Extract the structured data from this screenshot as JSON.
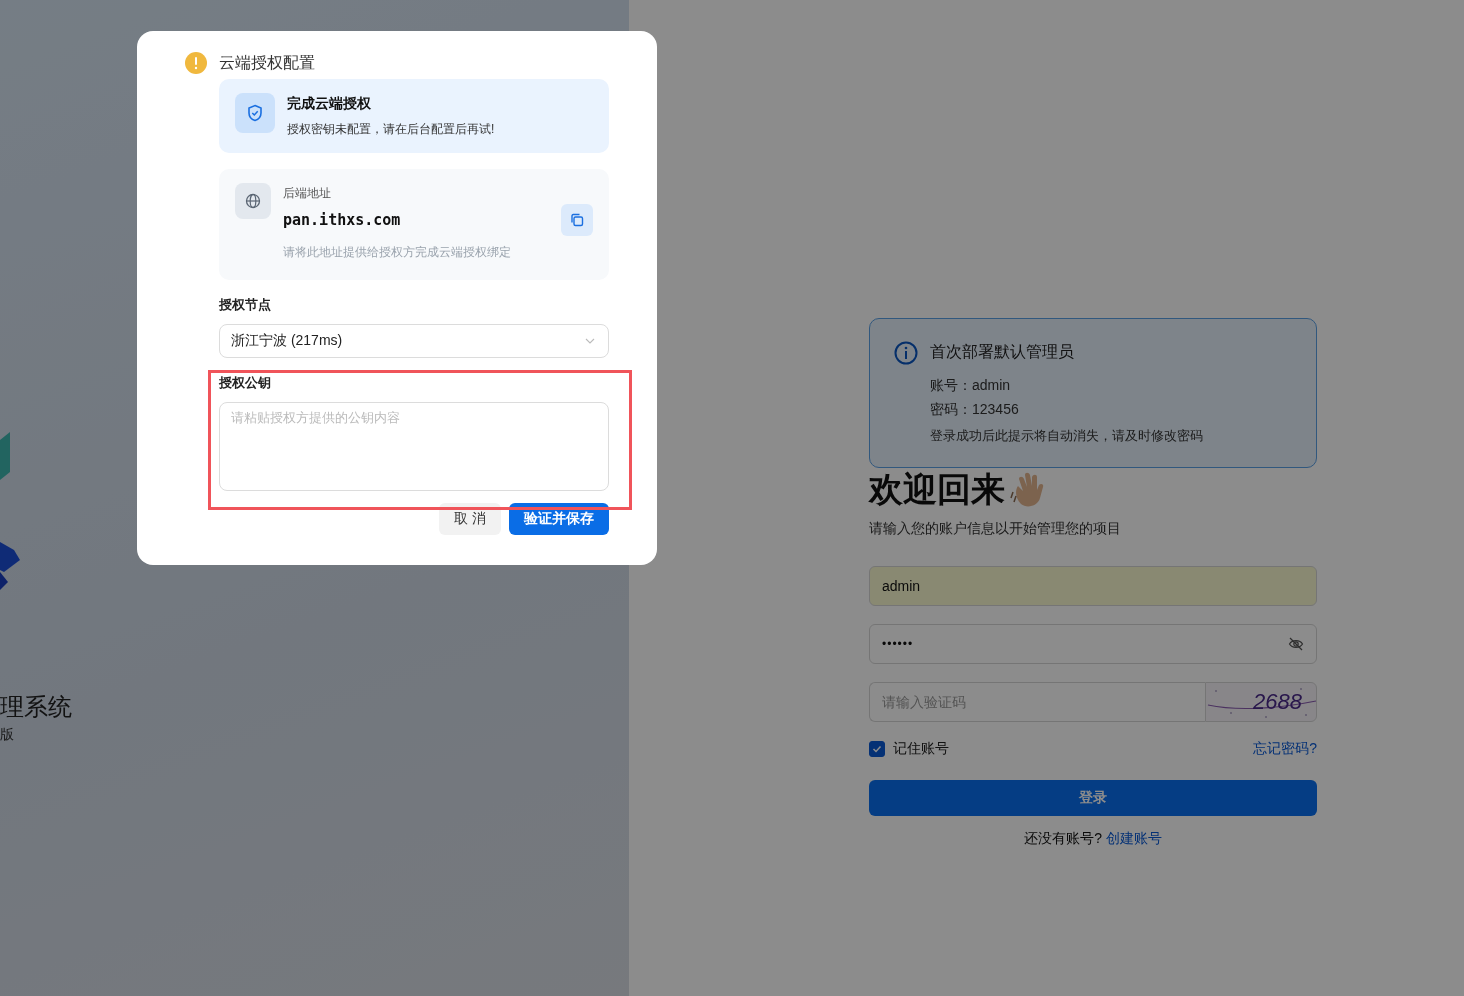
{
  "brand": {
    "title": "理系统",
    "subtitle": "版"
  },
  "login": {
    "notice": {
      "title": "首次部署默认管理员",
      "lines": [
        "账号：admin",
        "密码：123456"
      ],
      "note": "登录成功后此提示将自动消失，请及时修改密码"
    },
    "heading": "欢迎回来",
    "subtitle": "请输入您的账户信息以开始管理您的项目",
    "username": {
      "value": "admin",
      "autofilled": true
    },
    "password": {
      "value": "••••••"
    },
    "captcha": {
      "placeholder": "请输入验证码",
      "code": "2688"
    },
    "remember": {
      "label": "记住账号",
      "checked": true
    },
    "forgot_link": "忘记密码?",
    "login_button": "登录",
    "footer": {
      "question": "还没有账号?",
      "link": "创建账号"
    }
  },
  "dialog": {
    "title": "云端授权配置",
    "status_card": {
      "title": "完成云端授权",
      "message": "授权密钥未配置，请在后台配置后再试!"
    },
    "backend": {
      "label": "后端地址",
      "address": "pan.ithxs.com",
      "hint": "请将此地址提供给授权方完成云端授权绑定"
    },
    "node": {
      "label": "授权节点",
      "value": "浙江宁波 (217ms)"
    },
    "public_key": {
      "label": "授权公钥",
      "placeholder": "请粘贴授权方提供的公钥内容",
      "highlighted": true
    },
    "buttons": [
      {
        "label": "取 消",
        "kind": "secondary"
      },
      {
        "label": "验证并保存",
        "kind": "primary"
      }
    ]
  }
}
